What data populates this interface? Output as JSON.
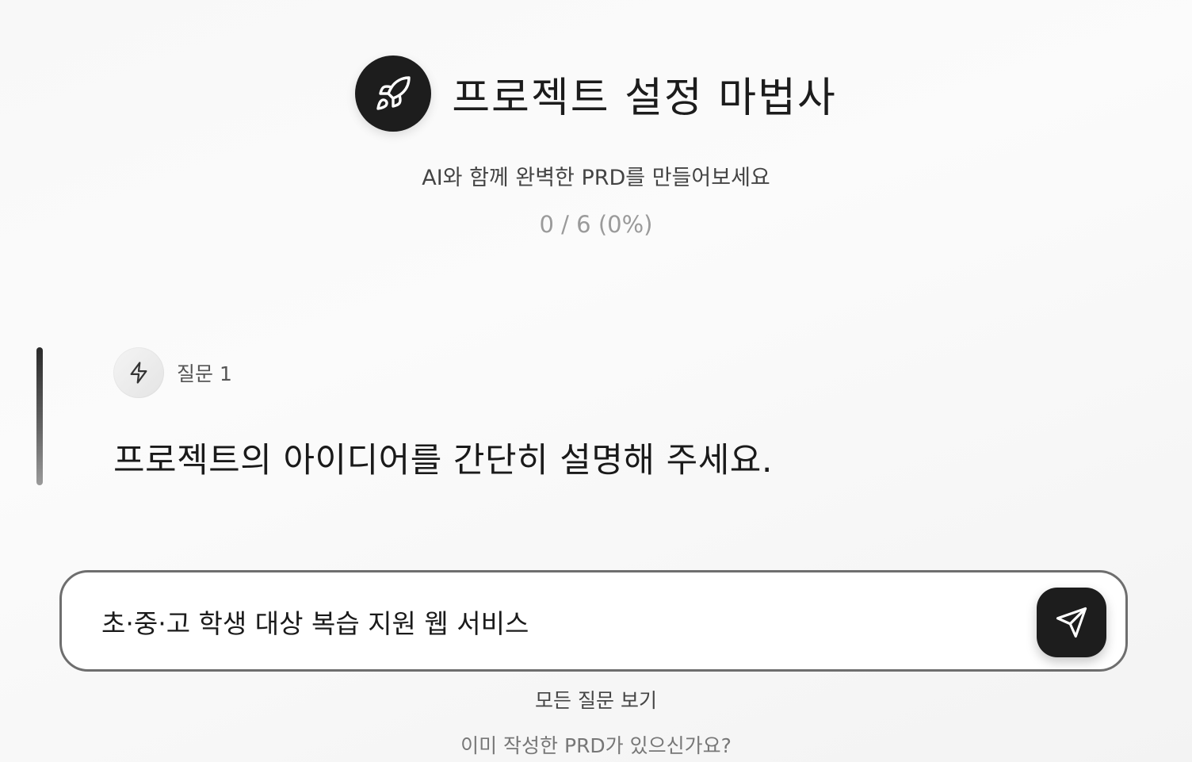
{
  "header": {
    "title": "프로젝트 설정 마법사",
    "subtitle": "AI와 함께 완벽한 PRD를 만들어보세요",
    "progress_text": "0 / 6 (0%)",
    "progress": {
      "current": 0,
      "total": 6,
      "percent": 0
    },
    "logo_icon": "rocket-icon"
  },
  "question": {
    "badge_icon": "bolt-icon",
    "number_label": "질문 1",
    "text": "프로젝트의 아이디어를 간단히 설명해 주세요."
  },
  "answer": {
    "value": "초·중·고 학생 대상 복습 지원 웹 서비스",
    "send_icon": "send-icon"
  },
  "footer": {
    "view_all_label": "모든 질문 보기",
    "existing_prd_label": "이미 작성한 PRD가 있으신가요?"
  },
  "colors": {
    "accent": "#1d1d1d",
    "text_primary": "#1a1a1a",
    "text_muted": "#9a9a9a",
    "border": "#6e6e6e"
  }
}
